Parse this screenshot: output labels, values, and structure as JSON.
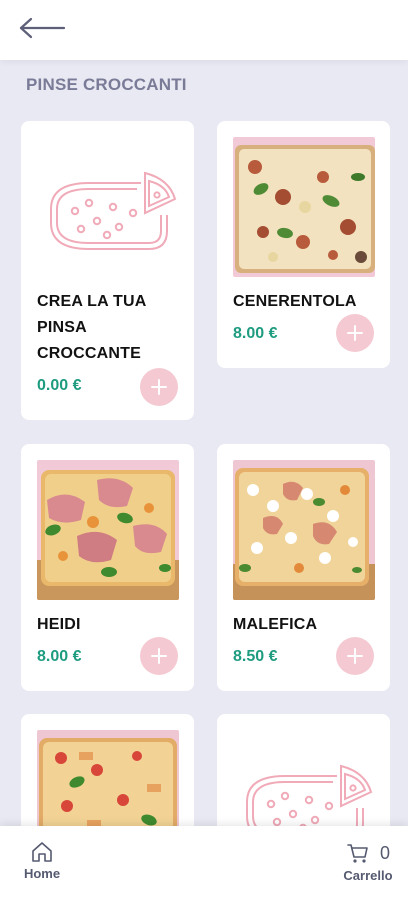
{
  "header": {
    "back_icon": "arrow-left-icon"
  },
  "section": {
    "title": "PINSE CROCCANTI"
  },
  "products": [
    {
      "name": "CREA LA TUA PINSA CROCCANTE",
      "price": "0.00 €",
      "image": "pinsa-outline-icon"
    },
    {
      "name": "CENERENTOLA",
      "price": "8.00 €",
      "image": "pizza-photo"
    },
    {
      "name": "HEIDI",
      "price": "8.00 €",
      "image": "pizza-photo"
    },
    {
      "name": "MALEFICA",
      "price": "8.50 €",
      "image": "pizza-photo"
    },
    {
      "name": "",
      "price": "",
      "image": "pizza-photo"
    },
    {
      "name": "",
      "price": "",
      "image": "pinsa-outline-icon"
    }
  ],
  "bottom_nav": {
    "home_label": "Home",
    "cart_label": "Carrello",
    "cart_count": "0"
  },
  "colors": {
    "background": "#e9e9f3",
    "price": "#1f9c80",
    "add_button": "#f4c9d2",
    "outline_icon": "#f0aab8",
    "section_title": "#7a7b97"
  }
}
